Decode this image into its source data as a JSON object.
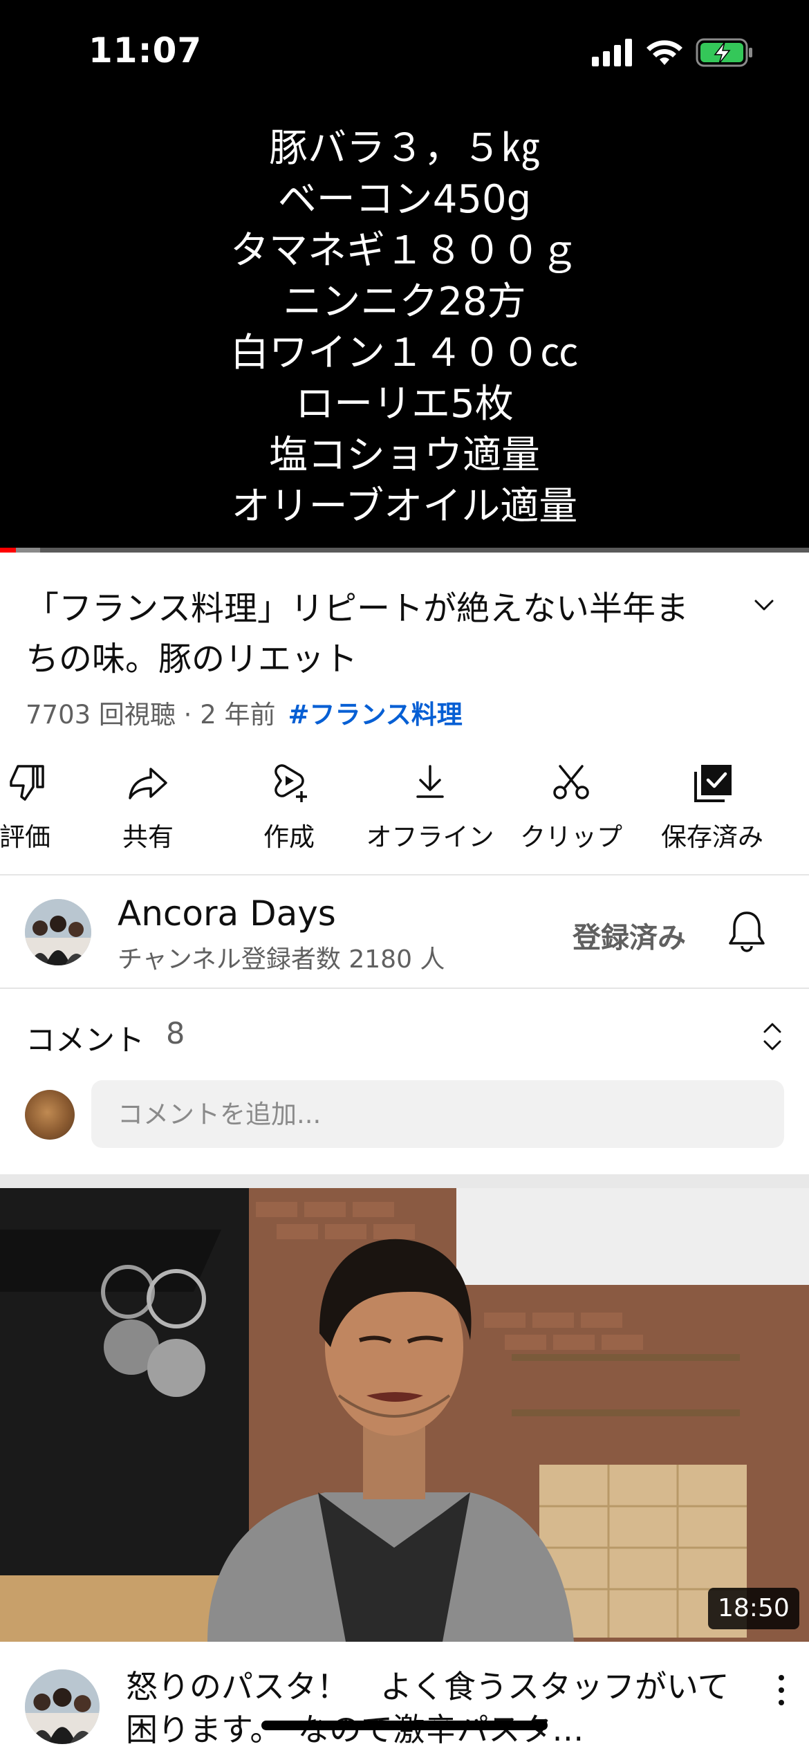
{
  "status_bar": {
    "time": "11:07",
    "battery": "charging"
  },
  "player": {
    "recipe_lines": [
      "豚バラ３，５㎏",
      "ベーコン450g",
      "タマネギ１８００ｇ",
      "ニンニク28方",
      "白ワイン１４００㏄",
      "ローリエ5枚",
      "塩コショウ適量",
      "オリーブオイル適量"
    ],
    "progress_played": 0.02,
    "progress_buffered": 0.05
  },
  "video": {
    "title": "「フランス料理」リピートが絶えない半年まちの味。豚のリエット",
    "meta": "7703 回視聴 · 2 年前",
    "hashtag": "#フランス料理"
  },
  "actions": [
    {
      "label": "評価",
      "icon": "thumbs-down-icon"
    },
    {
      "label": "共有",
      "icon": "share-icon"
    },
    {
      "label": "作成",
      "icon": "create-icon"
    },
    {
      "label": "オフライン",
      "icon": "download-icon"
    },
    {
      "label": "クリップ",
      "icon": "clip-icon"
    },
    {
      "label": "保存済み",
      "icon": "saved-icon"
    }
  ],
  "channel": {
    "name": "Ancora Days",
    "subscribers": "チャンネル登録者数 2180 人",
    "subscribe_state": "登録済み"
  },
  "comments": {
    "label": "コメント",
    "count": "8",
    "placeholder": "コメントを追加..."
  },
  "next_video": {
    "duration": "18:50",
    "title": "怒りのパスタ！　よく食うスタッフがいて困ります。　なので激辛パスタ…"
  },
  "colors": {
    "accent_red": "#ff0000",
    "link_blue": "#065fd4",
    "secondary_text": "#606060"
  }
}
